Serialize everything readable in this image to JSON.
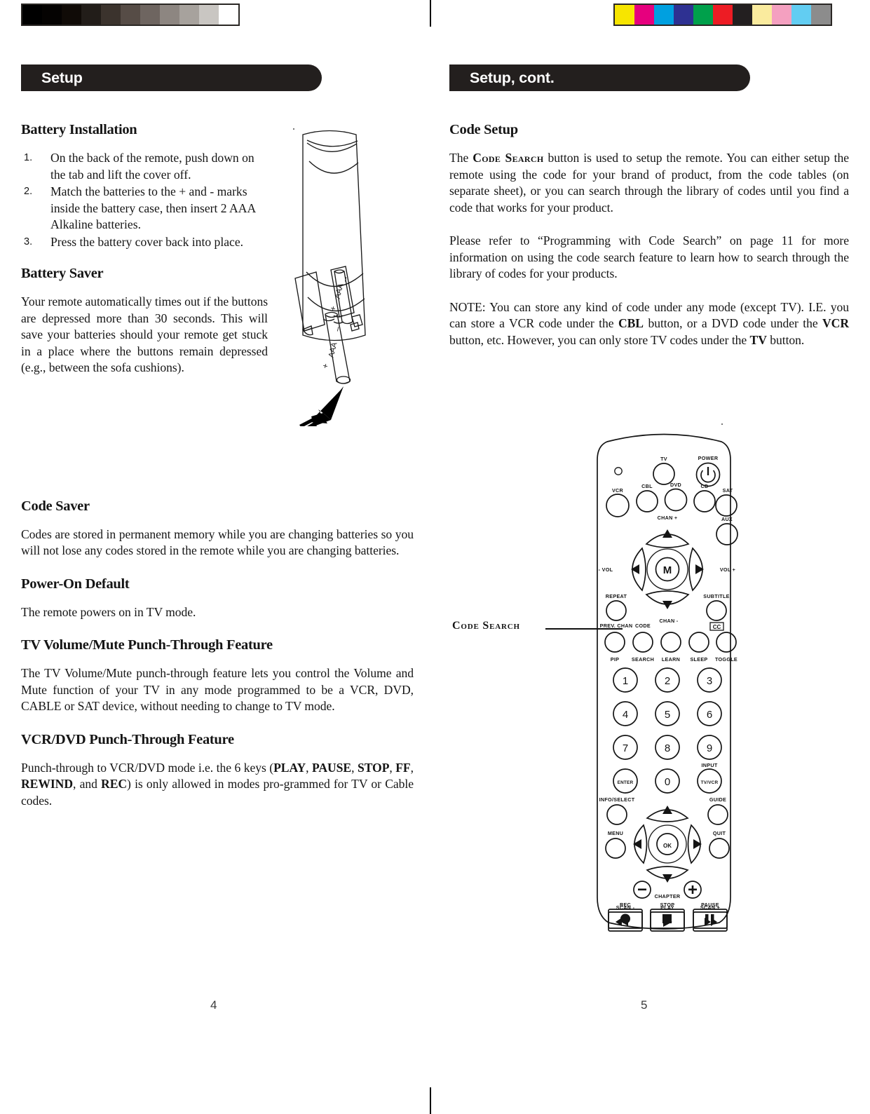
{
  "calibration": {
    "gray_strip": [
      "#000000",
      "#050302",
      "#100b07",
      "#221d19",
      "#3b332d",
      "#564c46",
      "#6e6560",
      "#8d8681",
      "#a7a29d",
      "#c9c6c2",
      "#ffffff"
    ],
    "color_strip": [
      "#f7e500",
      "#e6007e",
      "#00a0e0",
      "#2e3192",
      "#00a04b",
      "#ed1c24",
      "#231f20",
      "#faeb9e",
      "#f4a0c0",
      "#62cdf2",
      "#8c8c8c"
    ]
  },
  "left_page": {
    "banner": "Setup",
    "folio": "4",
    "sections": [
      {
        "heading": "Battery Installation",
        "steps": [
          {
            "num": "1.",
            "text": "On the back of the remote, push down on the tab and lift the cover off."
          },
          {
            "num": "2.",
            "text": "Match the batteries to the + and - marks inside the battery case, then insert 2 AAA Alkaline batteries."
          },
          {
            "num": "3.",
            "text": "Press the battery cover back into place."
          }
        ]
      },
      {
        "heading": "Battery Saver",
        "body": "Your remote automatically times out if the buttons are depressed more than 30 seconds. This will save your batteries should your remote get stuck in a place where the buttons remain depressed (e.g., between the sofa cushions)."
      },
      {
        "heading": "Code Saver",
        "body": "Codes are stored in permanent memory while you are changing batteries so you will not lose any codes stored in the remote while you are changing batteries."
      },
      {
        "heading": "Power-On Default",
        "body": "The remote powers on in TV mode."
      },
      {
        "heading": "TV Volume/Mute Punch-Through Feature",
        "body": "The TV Volume/Mute punch-through feature lets you control the Volume and Mute function of your TV in any mode programmed to be a VCR, DVD, CABLE or SAT device, without needing to change to TV mode."
      },
      {
        "heading": "VCR/DVD Punch-Through Feature",
        "body_parts": [
          {
            "text": "Punch-through to VCR/DVD mode i.e. the 6 keys (",
            "bold": false
          },
          {
            "text": "PLAY",
            "bold": true
          },
          {
            "text": ", ",
            "bold": false
          },
          {
            "text": "PAUSE",
            "bold": true
          },
          {
            "text": ", ",
            "bold": false
          },
          {
            "text": "STOP",
            "bold": true
          },
          {
            "text": ", ",
            "bold": false
          },
          {
            "text": "FF",
            "bold": true
          },
          {
            "text": ", ",
            "bold": false
          },
          {
            "text": "REWIND",
            "bold": true
          },
          {
            "text": ", and ",
            "bold": false
          },
          {
            "text": "REC",
            "bold": true
          },
          {
            "text": ") is only allowed in modes pro-grammed for TV or Cable codes.",
            "bold": false
          }
        ]
      }
    ],
    "artwork": {
      "name": "battery-installation-diagram",
      "battery_labels": [
        "AAA",
        "AAA"
      ],
      "polarity_marks": [
        "+",
        "−",
        "+",
        "−"
      ]
    }
  },
  "right_page": {
    "banner": "Setup, cont.",
    "folio": "5",
    "heading": "Code Setup",
    "paragraph_1": {
      "before": "The ",
      "smallcaps": "Code Search",
      "after": " button is used to setup the remote. You can either setup the remote using the code for your brand of product, from the code tables (on separate sheet), or you can search through the library of codes until you find a code that works for your product."
    },
    "paragraph_2": "Please refer to “Programming with Code Search” on page 11 for more information on using the code search feature to learn how to search through the library of codes for your products.",
    "paragraph_3_parts": [
      {
        "text": "NOTE: You can store any kind of code under any mode (except TV). I.E. you can store a VCR code under the ",
        "bold": false
      },
      {
        "text": "CBL",
        "bold": true
      },
      {
        "text": " button, or a DVD code under the ",
        "bold": false
      },
      {
        "text": "VCR",
        "bold": true
      },
      {
        "text": " button, etc. However, you can only store TV codes under the ",
        "bold": false
      },
      {
        "text": "TV",
        "bold": true
      },
      {
        "text": " button.",
        "bold": false
      }
    ],
    "callout_label": "Code Search",
    "remote": {
      "name": "universal-remote-diagram",
      "led": "",
      "device_buttons": [
        "VCR",
        "CBL",
        "DVD",
        "CD",
        "SAT"
      ],
      "top_buttons": [
        "TV",
        "POWER"
      ],
      "aux_button": "AUX",
      "channel_up": "CHAN +",
      "channel_down": "CHAN -",
      "volume_down": "- VOL",
      "volume_up": "VOL +",
      "center_mute": "M",
      "repeat": "REPEAT",
      "prev_chan": "PREV. CHAN",
      "subtitle": "SUBTITLE",
      "cc": "CC",
      "function_row": [
        {
          "top": "",
          "bottom": "PIP"
        },
        {
          "top": "CODE",
          "bottom": "SEARCH"
        },
        {
          "top": "",
          "bottom": "LEARN"
        },
        {
          "top": "",
          "bottom": "SLEEP"
        },
        {
          "top": "",
          "bottom": "TOGGLE"
        }
      ],
      "keypad": [
        "1",
        "2",
        "3",
        "4",
        "5",
        "6",
        "7",
        "8",
        "9",
        "ENTER",
        "0",
        "TV/VCR"
      ],
      "input_label": "INPUT",
      "info_select": "INFO/SELECT",
      "guide": "GUIDE",
      "menu": "MENU",
      "quit": "QUIT",
      "ok": "OK",
      "chapter": "CHAPTER",
      "chapter_minus": "−",
      "chapter_plus": "+",
      "transport_row_1": [
        "SCAN -",
        "PLAY",
        "SCAN +"
      ],
      "transport_row_2": [
        "REC",
        "STOP",
        "PAUSE"
      ]
    }
  }
}
